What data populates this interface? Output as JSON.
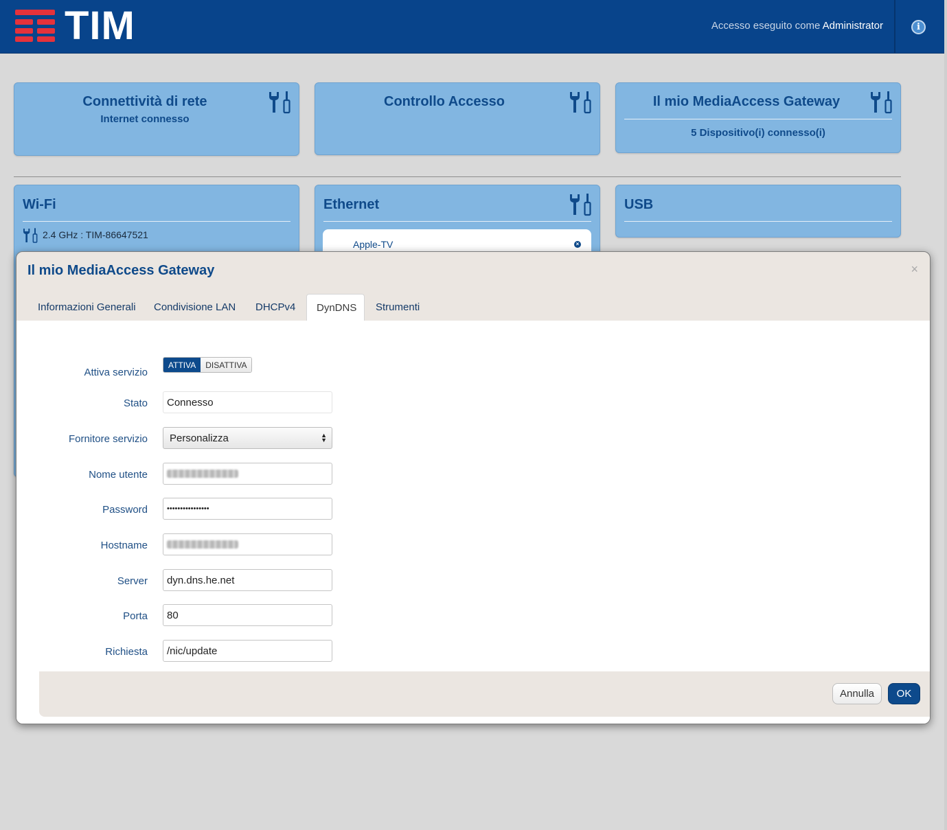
{
  "header": {
    "logo_text": "TIM",
    "login_prefix": "Accesso eseguito come",
    "login_user": "Administrator",
    "info_glyph": "i",
    "colors": {
      "bar": "#08448b",
      "logo_red": "#e5323b"
    }
  },
  "cards": {
    "network": {
      "title": "Connettività di rete",
      "subtitle": "Internet connesso"
    },
    "access": {
      "title": "Controllo Accesso"
    },
    "gateway": {
      "title": "Il mio MediaAccess Gateway",
      "subtitle": "5 Dispositivo(i) connesso(i)"
    },
    "wifi": {
      "title": "Wi-Fi",
      "network": "2.4 GHz : TIM-86647521"
    },
    "ethernet": {
      "title": "Ethernet",
      "device": "Apple-TV"
    },
    "usb": {
      "title": "USB"
    }
  },
  "modal": {
    "title": "Il mio MediaAccess Gateway",
    "close": "×",
    "tabs": [
      {
        "label": "Informazioni Generali"
      },
      {
        "label": "Condivisione LAN"
      },
      {
        "label": "DHCPv4"
      },
      {
        "label": "DynDNS"
      },
      {
        "label": "Strumenti"
      }
    ],
    "active_tab": "DynDNS",
    "form": {
      "service_label": "Attiva servizio",
      "toggle_on": "ATTIVA",
      "toggle_off": "DISATTIVA",
      "status_label": "Stato",
      "status_value": "Connesso",
      "provider_label": "Fornitore servizio",
      "provider_value": "Personalizza",
      "username_label": "Nome utente",
      "password_label": "Password",
      "password_value": "••••••••••••••••",
      "hostname_label": "Hostname",
      "server_label": "Server",
      "server_value": "dyn.dns.he.net",
      "port_label": "Porta",
      "port_value": "80",
      "request_label": "Richiesta",
      "request_value": "/nic/update"
    },
    "buttons": {
      "cancel": "Annulla",
      "ok": "OK"
    }
  }
}
